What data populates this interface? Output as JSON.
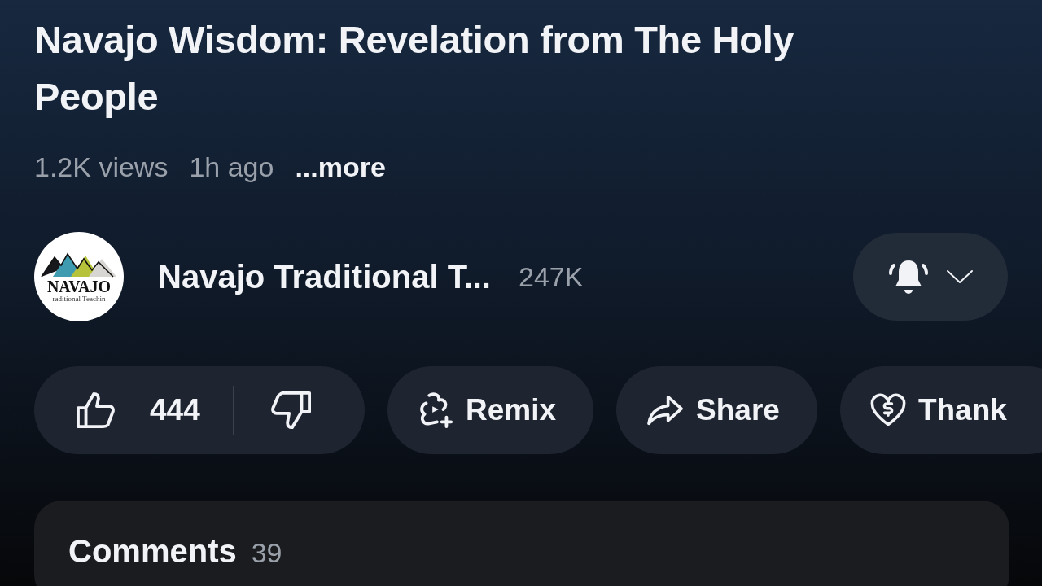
{
  "video": {
    "title": "Navajo Wisdom: Revelation from The Holy People",
    "views": "1.2K views",
    "age": "1h ago",
    "more": "...more"
  },
  "channel": {
    "name": "Navajo Traditional T...",
    "subscribers": "247K",
    "logo_text": "NAVAJO",
    "logo_subtext": "raditional Teachin"
  },
  "actions": [
    {
      "kind": "like",
      "count": "444"
    },
    {
      "kind": "remix",
      "label": "Remix"
    },
    {
      "kind": "share",
      "label": "Share"
    },
    {
      "kind": "thanks",
      "label": "Thank"
    }
  ],
  "comments": {
    "title": "Comments",
    "count": "39"
  }
}
